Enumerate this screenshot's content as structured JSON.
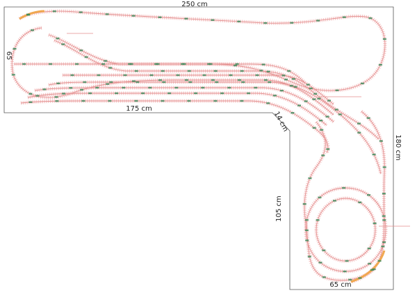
{
  "dimensions": {
    "top_width": "250 cm",
    "left_height": "65",
    "inner_width": "175 cm",
    "diagonal": "14 cm",
    "leg_height": "105 cm",
    "right_height": "180 cm",
    "bottom_width": "65 cm"
  },
  "colors": {
    "board_outline": "#555555",
    "track_rail": "#e48e8e",
    "track_tie": "#f3c2c2",
    "turnout_marker": "#3a8a5a",
    "grade_track": "#f0a850",
    "connector_line": "#e48e8e"
  }
}
